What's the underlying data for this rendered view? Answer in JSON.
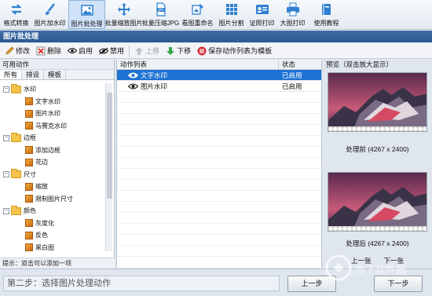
{
  "toolbar": [
    {
      "label": "格式转换",
      "icon": "convert-icon",
      "color": "#2f7fd1"
    },
    {
      "label": "图片加水印",
      "icon": "brush-icon",
      "color": "#2f7fd1"
    },
    {
      "label": "图片批处理",
      "icon": "image-icon",
      "color": "#2f7fd1",
      "active": true
    },
    {
      "label": "批量缩放图片",
      "icon": "move-arrows-icon",
      "color": "#2f7fd1"
    },
    {
      "label": "批量压缩JPG",
      "icon": "jpg-file-icon",
      "color": "#2f7fd1"
    },
    {
      "label": "看图重命名",
      "icon": "rename-icon",
      "color": "#2f7fd1"
    },
    {
      "label": "图片分割",
      "icon": "grid-icon",
      "color": "#2f7fd1"
    },
    {
      "label": "证照打印",
      "icon": "id-card-icon",
      "color": "#2f7fd1"
    },
    {
      "label": "大图打印",
      "icon": "printer-icon",
      "color": "#2f7fd1"
    },
    {
      "label": "使用教程",
      "icon": "book-icon",
      "color": "#2f7fd1"
    }
  ],
  "section_title": "图片批处理",
  "actions": {
    "edit": "修改",
    "delete": "删除",
    "enable": "启用",
    "disable": "禁用",
    "move_up": "上移",
    "move_down": "下移",
    "save_template": "保存动作列表为模板"
  },
  "left_panel": {
    "header": "可用动作",
    "tabs": [
      "所有",
      "排设",
      "模板"
    ],
    "tree": [
      {
        "label": "水印",
        "level": 1,
        "type": "folder"
      },
      {
        "label": "文字水印",
        "level": 2,
        "type": "item"
      },
      {
        "label": "图片水印",
        "level": 2,
        "type": "item"
      },
      {
        "label": "马赛克水印",
        "level": 2,
        "type": "item"
      },
      {
        "label": "边框",
        "level": 1,
        "type": "folder"
      },
      {
        "label": "添加边框",
        "level": 2,
        "type": "item"
      },
      {
        "label": "花边",
        "level": 2,
        "type": "item"
      },
      {
        "label": "尺寸",
        "level": 1,
        "type": "folder"
      },
      {
        "label": "缩放",
        "level": 2,
        "type": "item"
      },
      {
        "label": "限制图片尺寸",
        "level": 2,
        "type": "item"
      },
      {
        "label": "颜色",
        "level": 1,
        "type": "folder"
      },
      {
        "label": "灰度化",
        "level": 2,
        "type": "item"
      },
      {
        "label": "反色",
        "level": 2,
        "type": "item"
      },
      {
        "label": "黑白图",
        "level": 2,
        "type": "item"
      }
    ],
    "hint": "提示：双击可以添加一项"
  },
  "action_list": {
    "col_name": "动作列表",
    "col_status": "状态",
    "rows": [
      {
        "name": "文字水印",
        "status": "已启用",
        "selected": true
      },
      {
        "name": "图片水印",
        "status": "已启用",
        "selected": false
      }
    ]
  },
  "preview": {
    "header": "预览（双击放大显示）",
    "before_label": "处理前 (4267 x 2400)",
    "after_label": "处理后 (4267 x 2400)",
    "prev": "上一张",
    "next": "下一张"
  },
  "bottom": {
    "step": "第二步：选择图片处理动作",
    "prev_button": "上一步",
    "next_button": "下一步"
  },
  "watermark": "当下软件园"
}
